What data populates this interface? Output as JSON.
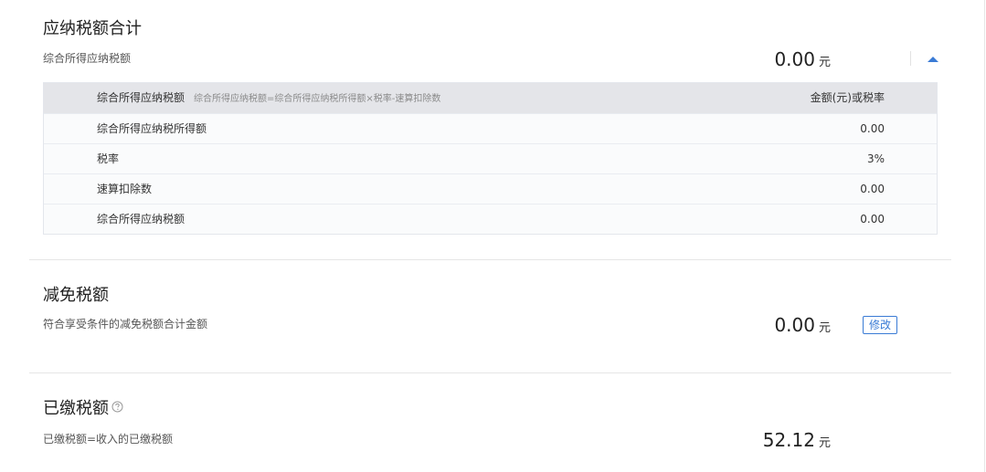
{
  "payable": {
    "title": "应纳税额合计",
    "subtitle": "综合所得应纳税额",
    "amount": "0.00",
    "unit": "元",
    "collapse_icon": "caret-up-icon",
    "breakdown": {
      "header_name": "综合所得应纳税额",
      "header_formula": "综合所得应纳税额=综合所得应纳税所得额×税率-速算扣除数",
      "header_value": "金额(元)或税率",
      "rows": [
        {
          "name": "综合所得应纳税所得额",
          "value": "0.00"
        },
        {
          "name": "税率",
          "value": "3%"
        },
        {
          "name": "速算扣除数",
          "value": "0.00"
        },
        {
          "name": "综合所得应纳税额",
          "value": "0.00"
        }
      ]
    }
  },
  "reduction": {
    "title": "减免税额",
    "subtitle": "符合享受条件的减免税额合计金额",
    "amount": "0.00",
    "unit": "元",
    "edit_label": "修改"
  },
  "paid": {
    "title": "已缴税额",
    "help_icon": "help-circle-icon",
    "subtitle": "已缴税额=收入的已缴税额",
    "amount": "52.12",
    "unit": "元"
  },
  "colors": {
    "accent": "#3a7bd5",
    "table_header_bg": "#e4e5e9",
    "divider": "#e6e6e6"
  }
}
